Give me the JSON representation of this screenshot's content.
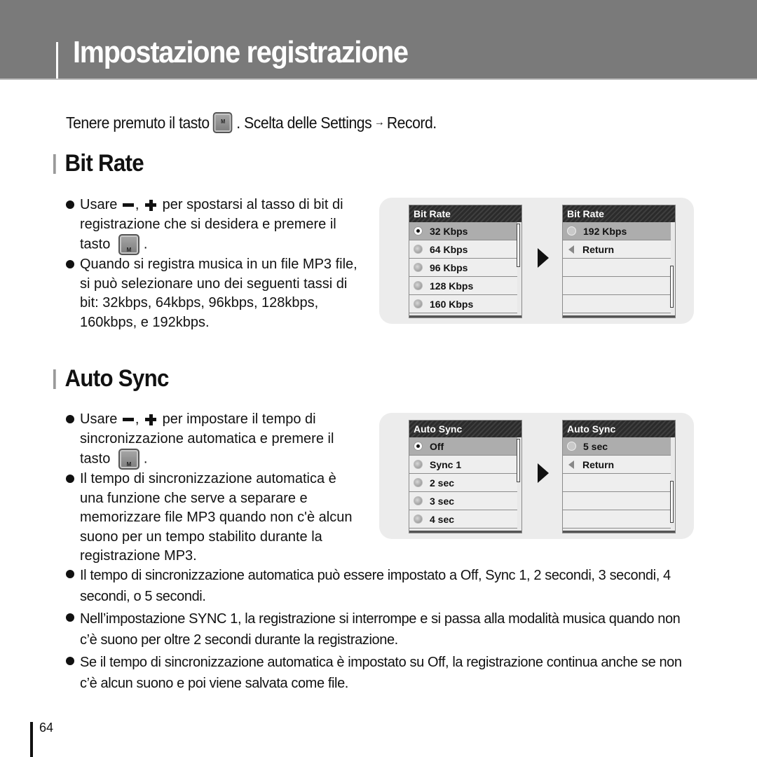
{
  "header": {
    "title": "Impostazione registrazione"
  },
  "intro": {
    "text_before": "Tenere premuto il tasto",
    "key_label": "M",
    "text_middle": ". Scelta delle Settings",
    "arrow": "→",
    "text_after": "Record."
  },
  "sections": [
    {
      "title": "Bit Rate",
      "bullets": [
        {
          "pre": "Usare",
          "mid": ",",
          "post": "per spostarsi al tasso di bit di registrazione che si desidera e premere il tasto",
          "end": "."
        },
        {
          "text": "Quando si registra musica in un file MP3 file, si può selezionare uno dei seguenti tassi di bit: 32kbps, 64kbps, 96kbps, 128kbps, 160kbps, e 192kbps."
        }
      ],
      "screen1": {
        "title": "Bit Rate",
        "items": [
          "32 Kbps",
          "64 Kbps",
          "96 Kbps",
          "128 Kbps",
          "160 Kbps"
        ],
        "selected": "32 Kbps"
      },
      "screen2": {
        "title": "Bit Rate",
        "items": [
          "192 Kbps",
          "Return"
        ],
        "selected": "192 Kbps"
      }
    },
    {
      "title": "Auto Sync",
      "bullets": [
        {
          "pre": "Usare",
          "mid": ",",
          "post": "per impostare il tempo di sincronizzazione automatica e premere il tasto",
          "end": "."
        },
        {
          "text": "Il tempo di sincronizzazione automatica è una funzione che serve a separare e memorizzare file MP3 quando non c'è alcun suono per un tempo stabilito durante la registrazione MP3."
        },
        {
          "text": "Il tempo di sincronizzazione automatica può essere impostato a Off, Sync 1, 2 secondi, 3 secondi, 4 secondi, o 5 secondi."
        },
        {
          "text": "Nell’impostazione SYNC 1, la registrazione si interrompe e si passa alla modalità musica quando non c’è suono per oltre 2 secondi durante la registrazione."
        },
        {
          "text": "Se il tempo di sincronizzazione automatica è impostato su Off, la registrazione continua anche se non c’è alcun suono e poi viene salvata come file."
        }
      ],
      "screen1": {
        "title": "Auto Sync",
        "items": [
          "Off",
          "Sync 1",
          "2 sec",
          "3 sec",
          "4 sec"
        ],
        "selected": "Off"
      },
      "screen2": {
        "title": "Auto Sync",
        "items": [
          "5 sec",
          "Return"
        ],
        "selected": "5 sec"
      }
    }
  ],
  "icons": {
    "minus": "minus-button-icon",
    "plus": "plus-button-icon",
    "menu_key": "m-key-icon",
    "next": "right-arrow-icon",
    "return": "return-icon"
  },
  "footer": {
    "page_number": "64"
  }
}
